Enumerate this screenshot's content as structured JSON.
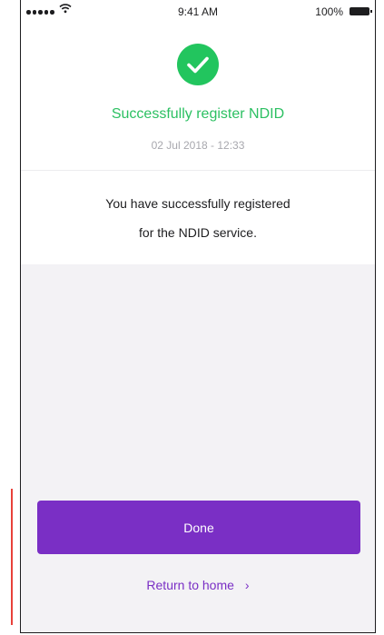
{
  "status_bar": {
    "time": "9:41 AM",
    "battery": "100%"
  },
  "header": {
    "icon": "check-icon",
    "title": "Successfully register NDID",
    "timestamp": "02 Jul 2018 - 12:33"
  },
  "message": {
    "line1": "You have successfully registered",
    "line2": "for the NDID service."
  },
  "actions": {
    "done_label": "Done",
    "return_label": "Return to home",
    "return_icon": "chevron-right-icon"
  },
  "colors": {
    "success": "#2cc062",
    "accent": "#7a2fc5",
    "background": "#f3f2f5"
  }
}
